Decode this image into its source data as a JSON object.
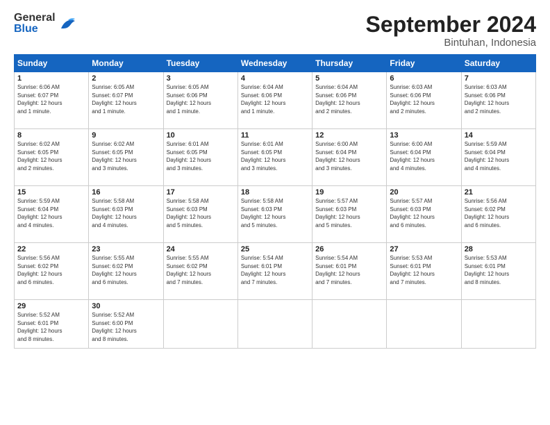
{
  "header": {
    "logo_general": "General",
    "logo_blue": "Blue",
    "month_title": "September 2024",
    "location": "Bintuhan, Indonesia"
  },
  "weekdays": [
    "Sunday",
    "Monday",
    "Tuesday",
    "Wednesday",
    "Thursday",
    "Friday",
    "Saturday"
  ],
  "weeks": [
    [
      {
        "day": "1",
        "lines": [
          "Sunrise: 6:06 AM",
          "Sunset: 6:07 PM",
          "Daylight: 12 hours",
          "and 1 minute."
        ]
      },
      {
        "day": "2",
        "lines": [
          "Sunrise: 6:05 AM",
          "Sunset: 6:07 PM",
          "Daylight: 12 hours",
          "and 1 minute."
        ]
      },
      {
        "day": "3",
        "lines": [
          "Sunrise: 6:05 AM",
          "Sunset: 6:06 PM",
          "Daylight: 12 hours",
          "and 1 minute."
        ]
      },
      {
        "day": "4",
        "lines": [
          "Sunrise: 6:04 AM",
          "Sunset: 6:06 PM",
          "Daylight: 12 hours",
          "and 1 minute."
        ]
      },
      {
        "day": "5",
        "lines": [
          "Sunrise: 6:04 AM",
          "Sunset: 6:06 PM",
          "Daylight: 12 hours",
          "and 2 minutes."
        ]
      },
      {
        "day": "6",
        "lines": [
          "Sunrise: 6:03 AM",
          "Sunset: 6:06 PM",
          "Daylight: 12 hours",
          "and 2 minutes."
        ]
      },
      {
        "day": "7",
        "lines": [
          "Sunrise: 6:03 AM",
          "Sunset: 6:06 PM",
          "Daylight: 12 hours",
          "and 2 minutes."
        ]
      }
    ],
    [
      {
        "day": "8",
        "lines": [
          "Sunrise: 6:02 AM",
          "Sunset: 6:05 PM",
          "Daylight: 12 hours",
          "and 2 minutes."
        ]
      },
      {
        "day": "9",
        "lines": [
          "Sunrise: 6:02 AM",
          "Sunset: 6:05 PM",
          "Daylight: 12 hours",
          "and 3 minutes."
        ]
      },
      {
        "day": "10",
        "lines": [
          "Sunrise: 6:01 AM",
          "Sunset: 6:05 PM",
          "Daylight: 12 hours",
          "and 3 minutes."
        ]
      },
      {
        "day": "11",
        "lines": [
          "Sunrise: 6:01 AM",
          "Sunset: 6:05 PM",
          "Daylight: 12 hours",
          "and 3 minutes."
        ]
      },
      {
        "day": "12",
        "lines": [
          "Sunrise: 6:00 AM",
          "Sunset: 6:04 PM",
          "Daylight: 12 hours",
          "and 3 minutes."
        ]
      },
      {
        "day": "13",
        "lines": [
          "Sunrise: 6:00 AM",
          "Sunset: 6:04 PM",
          "Daylight: 12 hours",
          "and 4 minutes."
        ]
      },
      {
        "day": "14",
        "lines": [
          "Sunrise: 5:59 AM",
          "Sunset: 6:04 PM",
          "Daylight: 12 hours",
          "and 4 minutes."
        ]
      }
    ],
    [
      {
        "day": "15",
        "lines": [
          "Sunrise: 5:59 AM",
          "Sunset: 6:04 PM",
          "Daylight: 12 hours",
          "and 4 minutes."
        ]
      },
      {
        "day": "16",
        "lines": [
          "Sunrise: 5:58 AM",
          "Sunset: 6:03 PM",
          "Daylight: 12 hours",
          "and 4 minutes."
        ]
      },
      {
        "day": "17",
        "lines": [
          "Sunrise: 5:58 AM",
          "Sunset: 6:03 PM",
          "Daylight: 12 hours",
          "and 5 minutes."
        ]
      },
      {
        "day": "18",
        "lines": [
          "Sunrise: 5:58 AM",
          "Sunset: 6:03 PM",
          "Daylight: 12 hours",
          "and 5 minutes."
        ]
      },
      {
        "day": "19",
        "lines": [
          "Sunrise: 5:57 AM",
          "Sunset: 6:03 PM",
          "Daylight: 12 hours",
          "and 5 minutes."
        ]
      },
      {
        "day": "20",
        "lines": [
          "Sunrise: 5:57 AM",
          "Sunset: 6:03 PM",
          "Daylight: 12 hours",
          "and 6 minutes."
        ]
      },
      {
        "day": "21",
        "lines": [
          "Sunrise: 5:56 AM",
          "Sunset: 6:02 PM",
          "Daylight: 12 hours",
          "and 6 minutes."
        ]
      }
    ],
    [
      {
        "day": "22",
        "lines": [
          "Sunrise: 5:56 AM",
          "Sunset: 6:02 PM",
          "Daylight: 12 hours",
          "and 6 minutes."
        ]
      },
      {
        "day": "23",
        "lines": [
          "Sunrise: 5:55 AM",
          "Sunset: 6:02 PM",
          "Daylight: 12 hours",
          "and 6 minutes."
        ]
      },
      {
        "day": "24",
        "lines": [
          "Sunrise: 5:55 AM",
          "Sunset: 6:02 PM",
          "Daylight: 12 hours",
          "and 7 minutes."
        ]
      },
      {
        "day": "25",
        "lines": [
          "Sunrise: 5:54 AM",
          "Sunset: 6:01 PM",
          "Daylight: 12 hours",
          "and 7 minutes."
        ]
      },
      {
        "day": "26",
        "lines": [
          "Sunrise: 5:54 AM",
          "Sunset: 6:01 PM",
          "Daylight: 12 hours",
          "and 7 minutes."
        ]
      },
      {
        "day": "27",
        "lines": [
          "Sunrise: 5:53 AM",
          "Sunset: 6:01 PM",
          "Daylight: 12 hours",
          "and 7 minutes."
        ]
      },
      {
        "day": "28",
        "lines": [
          "Sunrise: 5:53 AM",
          "Sunset: 6:01 PM",
          "Daylight: 12 hours",
          "and 8 minutes."
        ]
      }
    ],
    [
      {
        "day": "29",
        "lines": [
          "Sunrise: 5:52 AM",
          "Sunset: 6:01 PM",
          "Daylight: 12 hours",
          "and 8 minutes."
        ]
      },
      {
        "day": "30",
        "lines": [
          "Sunrise: 5:52 AM",
          "Sunset: 6:00 PM",
          "Daylight: 12 hours",
          "and 8 minutes."
        ]
      },
      {
        "day": "",
        "lines": []
      },
      {
        "day": "",
        "lines": []
      },
      {
        "day": "",
        "lines": []
      },
      {
        "day": "",
        "lines": []
      },
      {
        "day": "",
        "lines": []
      }
    ]
  ]
}
